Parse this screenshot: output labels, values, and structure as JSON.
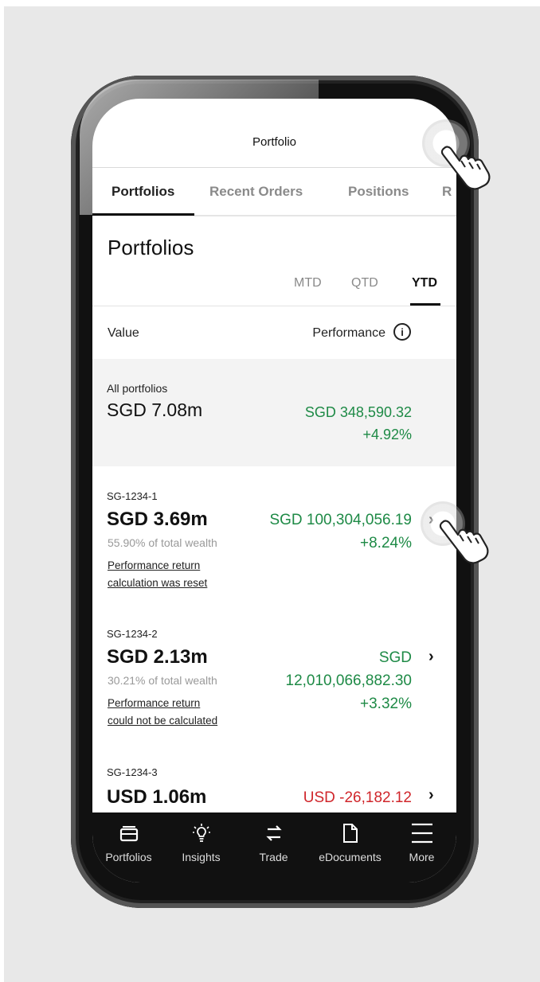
{
  "header": {
    "title": "Portfolio"
  },
  "tabs": [
    {
      "label": "Portfolios",
      "active": true
    },
    {
      "label": "Recent Orders",
      "active": false
    },
    {
      "label": "Positions",
      "active": false
    },
    {
      "label": "R",
      "active": false
    }
  ],
  "section": {
    "title": "Portfolios",
    "periods": [
      {
        "label": "MTD",
        "active": false
      },
      {
        "label": "QTD",
        "active": false
      },
      {
        "label": "YTD",
        "active": true
      }
    ],
    "columns": {
      "value": "Value",
      "performance": "Performance",
      "info_icon": "info-icon"
    }
  },
  "summary": {
    "label": "All portfolios",
    "value": "SGD 7.08m",
    "perf_amount": "SGD 348,590.32",
    "perf_pct": "+4.92%"
  },
  "portfolios": [
    {
      "id": "SG-1234-1",
      "value": "SGD 3.69m",
      "share": "55.90% of total wealth",
      "note_line1": "Performance return",
      "note_line2": "calculation was reset",
      "perf_amount": "SGD 100,304,056.19",
      "perf_pct": "+8.24%"
    },
    {
      "id": "SG-1234-2",
      "value": "SGD 2.13m",
      "share": "30.21% of total wealth",
      "note_line1": "Performance return",
      "note_line2": "could not be calculated",
      "perf_currency": "SGD",
      "perf_amount": "12,010,066,882.30",
      "perf_pct": "+3.32%"
    },
    {
      "id": "SG-1234-3",
      "value": "USD 1.06m",
      "perf_amount": "USD -26,182.12"
    }
  ],
  "bottom_nav": [
    {
      "label": "Portfolios",
      "icon": "portfolio-icon"
    },
    {
      "label": "Insights",
      "icon": "lightbulb-icon"
    },
    {
      "label": "Trade",
      "icon": "swap-icon"
    },
    {
      "label": "eDocuments",
      "icon": "document-icon"
    },
    {
      "label": "More",
      "icon": "menu-icon"
    }
  ],
  "colors": {
    "positive": "#1e8a46",
    "negative": "#d0262b",
    "nav_bg": "#111111"
  }
}
